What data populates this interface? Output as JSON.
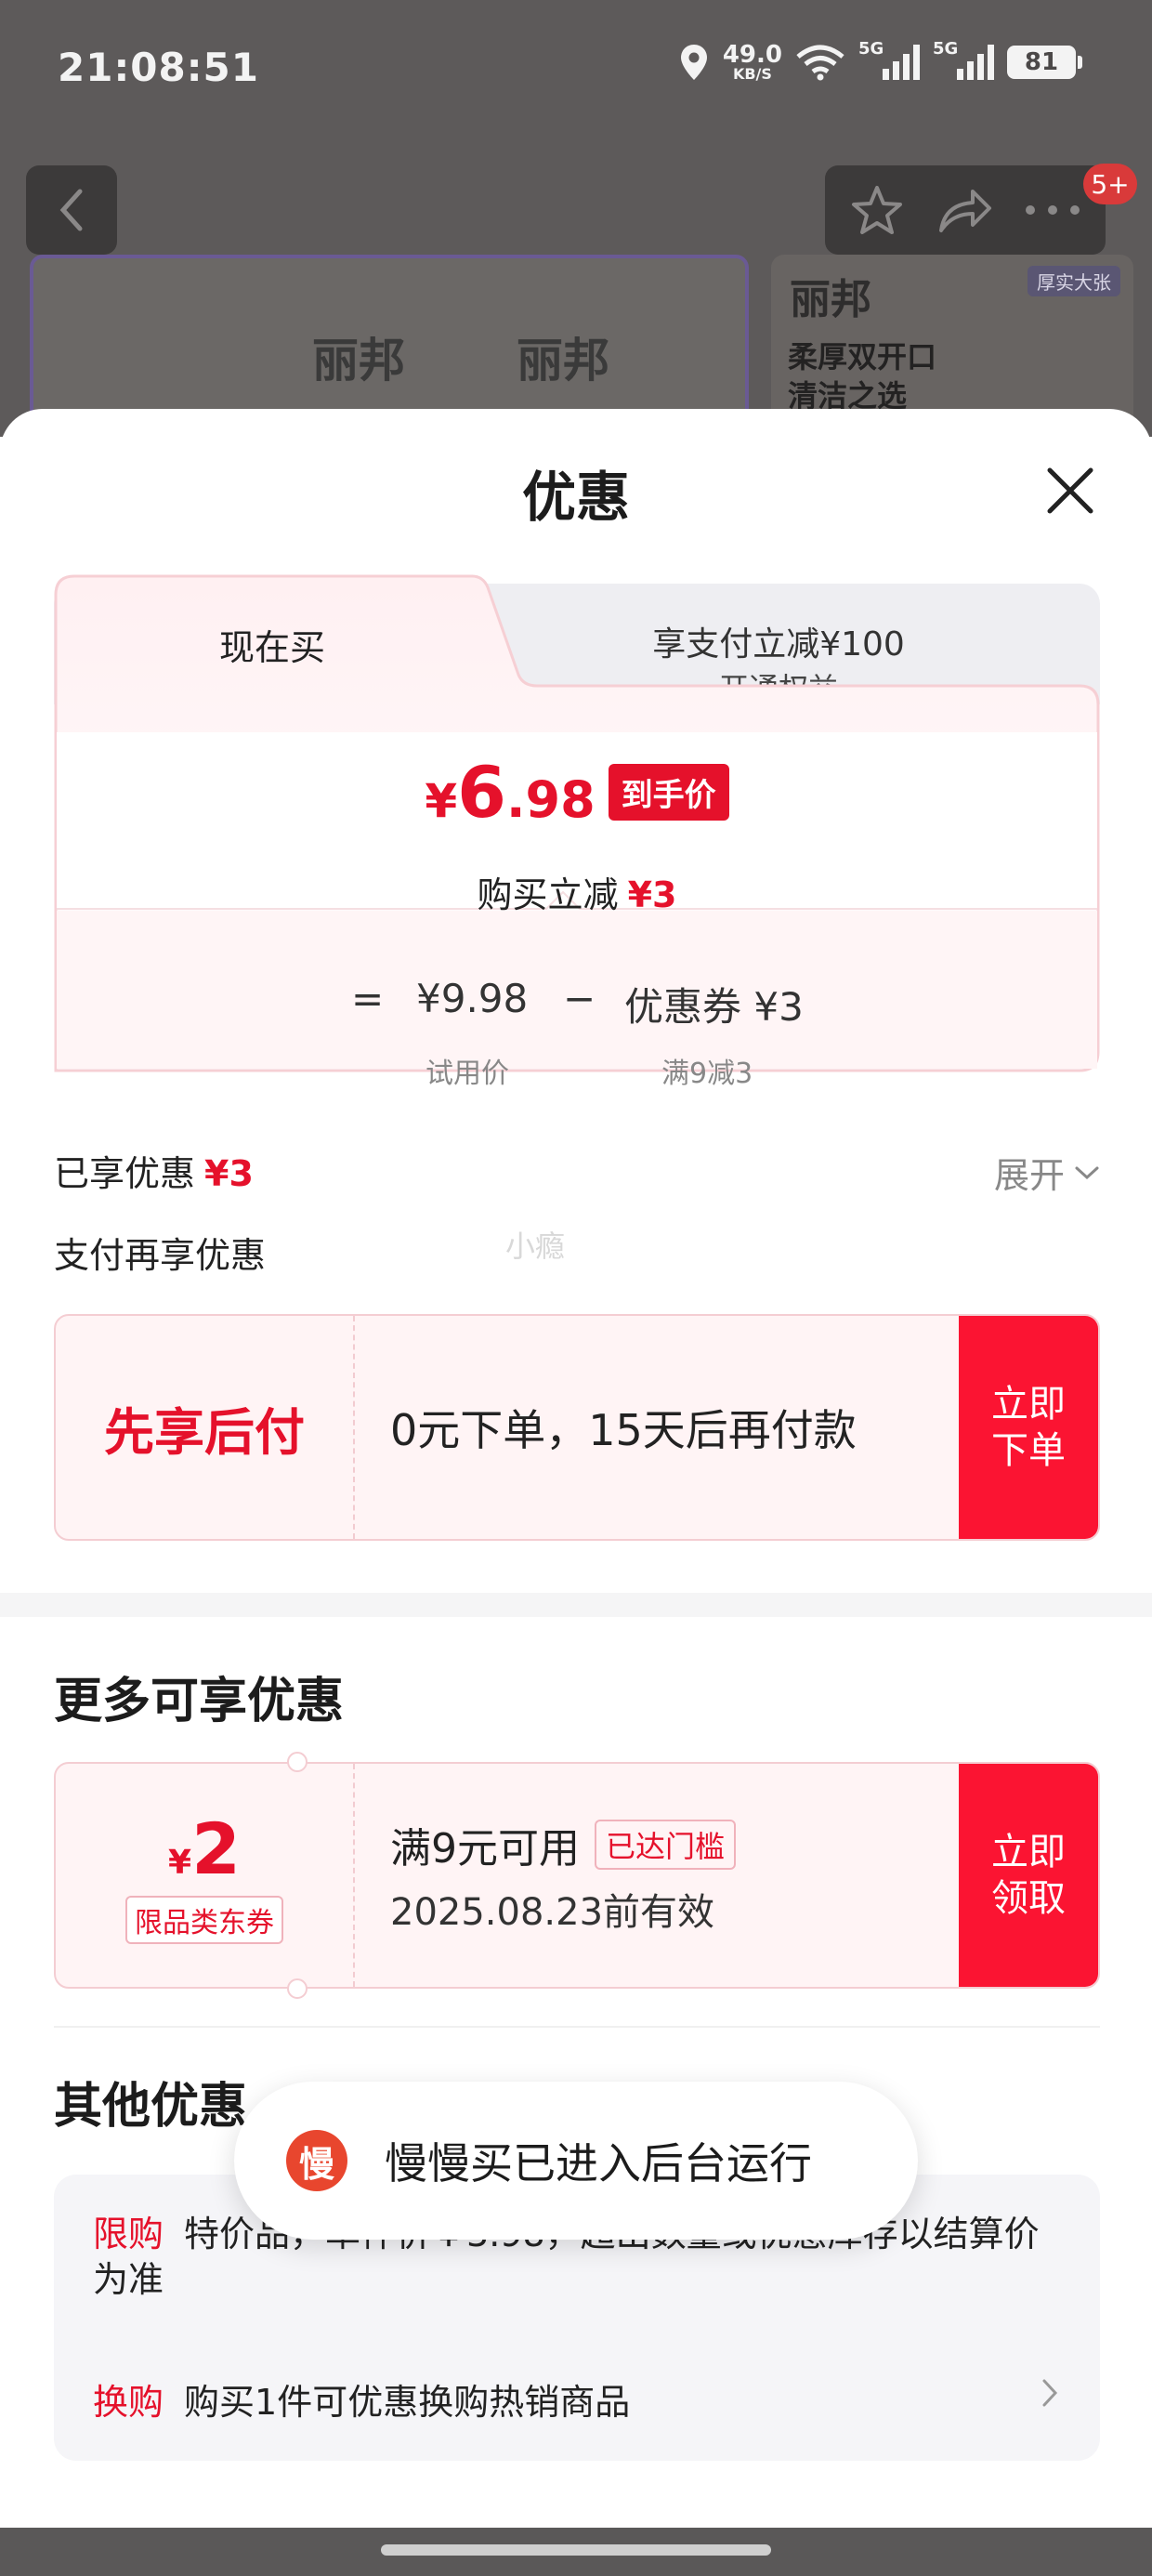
{
  "status_bar": {
    "time": "21:08:51",
    "net_speed_value": "49.0",
    "net_speed_unit": "KB/S",
    "signal1": "5G",
    "signal2": "5G",
    "battery": "81"
  },
  "background_page": {
    "badge": "5+",
    "brand_main": "丽邦",
    "brand_side": "丽邦",
    "side_slogan_line1": "柔厚双开口",
    "side_slogan_line2": "清洁之选",
    "side_tag": "厚实大张"
  },
  "sheet": {
    "title": "优惠",
    "tabs": {
      "left_label": "现在买",
      "right_title": "享支付立减¥100",
      "right_sub": "开通权益"
    },
    "price": {
      "currency": "¥",
      "integer": "6",
      "decimal": ".98",
      "tag": "到手价",
      "reduce_label": "购买立减",
      "reduce_amount": "¥3"
    },
    "calc": {
      "equals": "=",
      "trial_price": "¥9.98",
      "minus": "−",
      "coupon": "优惠券 ¥3",
      "trial_label": "试用价",
      "coupon_rule": "满9减3"
    },
    "enjoyed_label": "已享优惠",
    "enjoyed_amount": "¥3",
    "expand_label": "展开",
    "pay_more_label": "支付再享优惠",
    "watermark": "小瘾",
    "bnpl": {
      "title": "先享后付",
      "desc": "0元下单，15天后再付款",
      "button": "立即下单"
    },
    "more_title": "更多可享优惠",
    "coupon": {
      "currency": "¥",
      "amount": "2",
      "type": "限品类东券",
      "condition": "满9元可用",
      "reached": "已达门槛",
      "expiry": "2025.08.23前有效",
      "button": "立即领取"
    },
    "other_title": "其他优惠",
    "limit": {
      "label": "限购",
      "text": "特价品，单件价￥3.98，超出数量或优惠库存以结算价为准"
    },
    "swap": {
      "label": "换购",
      "text": "购买1件可优惠换购热销商品"
    }
  },
  "toast": {
    "icon_char": "慢",
    "text": "慢慢买已进入后台运行"
  },
  "colors": {
    "accent_red": "#e5112b",
    "button_red": "#fb1432",
    "card_pink": "#fff4f5"
  }
}
